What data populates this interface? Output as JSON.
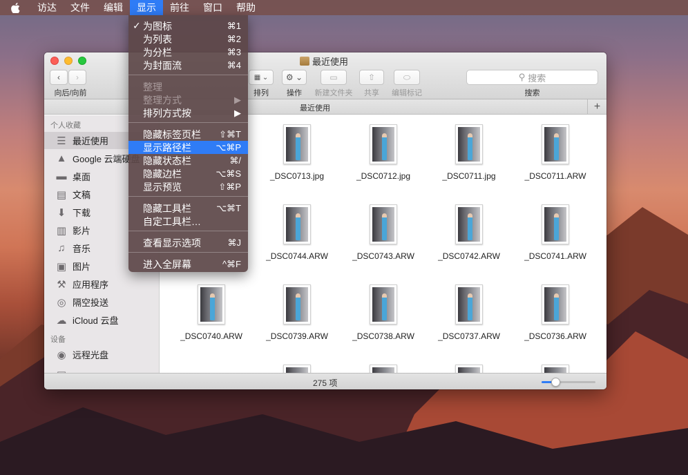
{
  "menubar": {
    "items": [
      {
        "label": "访达",
        "active": false
      },
      {
        "label": "文件",
        "active": false
      },
      {
        "label": "编辑",
        "active": false
      },
      {
        "label": "显示",
        "active": true
      },
      {
        "label": "前往",
        "active": false
      },
      {
        "label": "窗口",
        "active": false
      },
      {
        "label": "帮助",
        "active": false
      }
    ]
  },
  "menu": {
    "items": [
      {
        "label": "为图标",
        "shortcut": "⌘1",
        "checked": true
      },
      {
        "label": "为列表",
        "shortcut": "⌘2"
      },
      {
        "label": "为分栏",
        "shortcut": "⌘3"
      },
      {
        "label": "为封面流",
        "shortcut": "⌘4"
      },
      {
        "label": "整理",
        "shortcut": "",
        "disabled": true
      },
      {
        "label": "整理方式",
        "shortcut": "▶",
        "disabled": true
      },
      {
        "label": "排列方式按",
        "shortcut": "▶"
      },
      {
        "label": "隐藏标签页栏",
        "shortcut": "⇧⌘T"
      },
      {
        "label": "显示路径栏",
        "shortcut": "⌥⌘P",
        "highlighted": true
      },
      {
        "label": "隐藏状态栏",
        "shortcut": "⌘/"
      },
      {
        "label": "隐藏边栏",
        "shortcut": "⌥⌘S"
      },
      {
        "label": "显示预览",
        "shortcut": "⇧⌘P"
      },
      {
        "label": "隐藏工具栏",
        "shortcut": "⌥⌘T"
      },
      {
        "label": "自定工具栏…",
        "shortcut": ""
      },
      {
        "label": "查看显示选项",
        "shortcut": "⌘J"
      },
      {
        "label": "进入全屏幕",
        "shortcut": "^⌘F"
      }
    ]
  },
  "window": {
    "title": "最近使用",
    "path_title": "最近使用",
    "toolbar": {
      "back_forward_label": "向后/向前",
      "view_label": "排列",
      "action_label": "操作",
      "new_folder_label": "新建文件夹",
      "share_label": "共享",
      "edit_tags_label": "编辑标记",
      "search_placeholder": "搜索",
      "search_label": "搜索"
    },
    "status": "275 项",
    "icon_size_fraction": 0.25
  },
  "sidebar": {
    "favorites_header": "个人收藏",
    "devices_header": "设备",
    "favorites": [
      {
        "label": "最近使用",
        "icon": "recents-icon",
        "selected": true
      },
      {
        "label": "Google 云端硬盘",
        "icon": "google-drive-icon"
      },
      {
        "label": "桌面",
        "icon": "desktop-icon"
      },
      {
        "label": "文稿",
        "icon": "documents-icon"
      },
      {
        "label": "下载",
        "icon": "downloads-icon"
      },
      {
        "label": "影片",
        "icon": "movies-icon"
      },
      {
        "label": "音乐",
        "icon": "music-icon"
      },
      {
        "label": "图片",
        "icon": "pictures-icon"
      },
      {
        "label": "应用程序",
        "icon": "applications-icon"
      },
      {
        "label": "隔空投送",
        "icon": "airdrop-icon"
      },
      {
        "label": "iCloud 云盘",
        "icon": "icloud-icon"
      }
    ],
    "devices": [
      {
        "label": "远程光盘",
        "icon": "remote-disc-icon"
      }
    ]
  },
  "files": [
    [
      "",
      "_DSC0713.jpg",
      "_DSC0712.jpg",
      "_DSC0711.jpg",
      "_DSC0711.ARW"
    ],
    [
      "",
      "_DSC0744.ARW",
      "_DSC0743.ARW",
      "_DSC0742.ARW",
      "_DSC0741.ARW"
    ],
    [
      "_DSC0740.ARW",
      "_DSC0739.ARW",
      "_DSC0738.ARW",
      "_DSC0737.ARW",
      "_DSC0736.ARW"
    ]
  ]
}
